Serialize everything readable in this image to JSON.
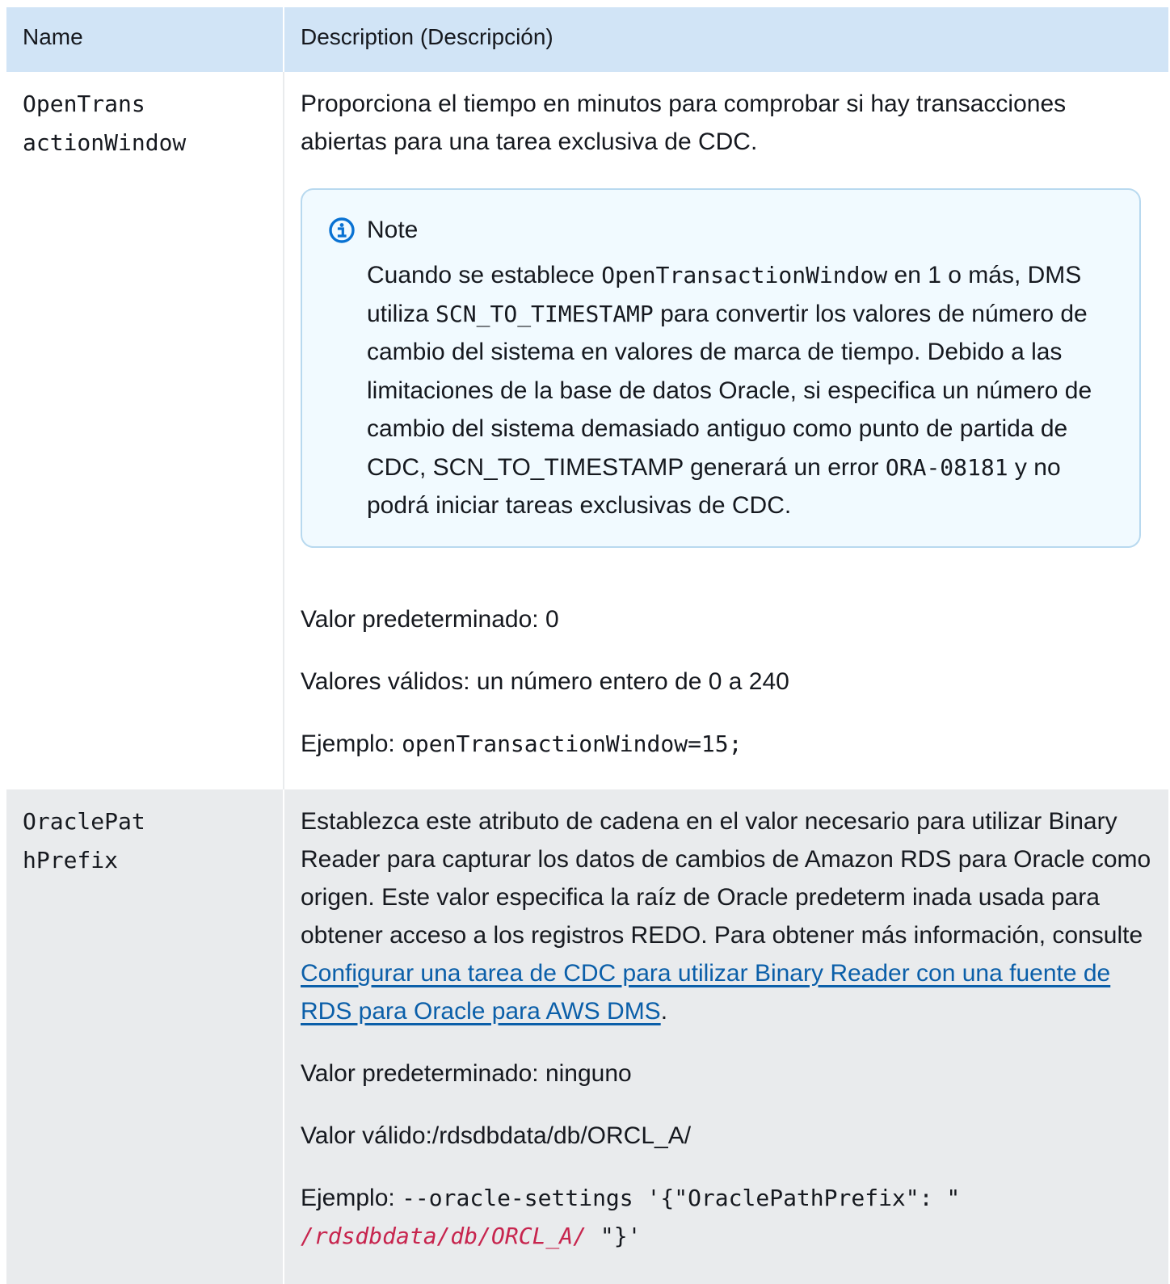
{
  "table": {
    "headers": {
      "name": "Name",
      "description": "Description (Descripción)"
    },
    "rows": [
      {
        "name_line1": "OpenTrans",
        "name_line2": "actionWindow",
        "desc_text": "Proporciona el tiempo en minutos para comprobar si hay transacciones abiertas para una tarea exclusiva de CDC.",
        "note": {
          "title": "Note",
          "t1": "Cuando se establece ",
          "c1": "OpenTransactionWindow",
          "t2": " en 1 o más, DMS utiliza ",
          "c2": "SCN_TO_TIMESTAMP",
          "t3": " para convertir los valores de número de cambio del sistema en valores de marca de tiempo. Debido a las limitaciones de la base de datos Oracle, si especifica un número de cambio del sistema demasiado antiguo como punto de partida de CDC, SCN_TO_TIMESTAMP generará un error ",
          "c3": "ORA-08181",
          "t4": " y no podrá iniciar tareas exclusivas de CDC."
        },
        "default_value": "Valor predeterminado: 0",
        "valid_values": "Valores válidos: un número entero de 0 a 240",
        "example_label": "Ejemplo: ",
        "example_code": "openTransactionWindow=15;"
      },
      {
        "name_line1": "OraclePat",
        "name_line2": "hPrefix",
        "desc_text": "Establezca este atributo de cadena en el valor necesario para utilizar Binary Reader para capturar los datos de cambios de Amazon RDS para Oracle como origen. Este valor especifica la raíz de Oracle predeterm inada usada para obtener acceso a los registros REDO. Para obtener más información, consulte ",
        "link_text": "Configurar una tarea de CDC para utilizar Binary Reader con una fuente de RDS para Oracle para AWS DMS",
        "desc_end": ".",
        "default_value": "Valor predeterminado: ninguno",
        "valid_value": "Valor válido:/rdsdbdata/db/ORCL_A/",
        "example_label": "Ejemplo: ",
        "example_code_1": "--oracle-settings '{\"OraclePathPrefix\": \"",
        "example_code_var": " /rdsdbdata/db/ORCL_A/ ",
        "example_code_2": "\"}'"
      }
    ]
  },
  "colors": {
    "header_bg": "#d1e4f6",
    "alt_row_bg": "#e9ebed",
    "link": "#0b5fa9",
    "note_bg": "#f1faff",
    "note_border": "#b8d9ef",
    "icon": "#0972d3",
    "code_var": "#c7254e"
  },
  "icons": {
    "note_icon": "info-circle-icon"
  }
}
